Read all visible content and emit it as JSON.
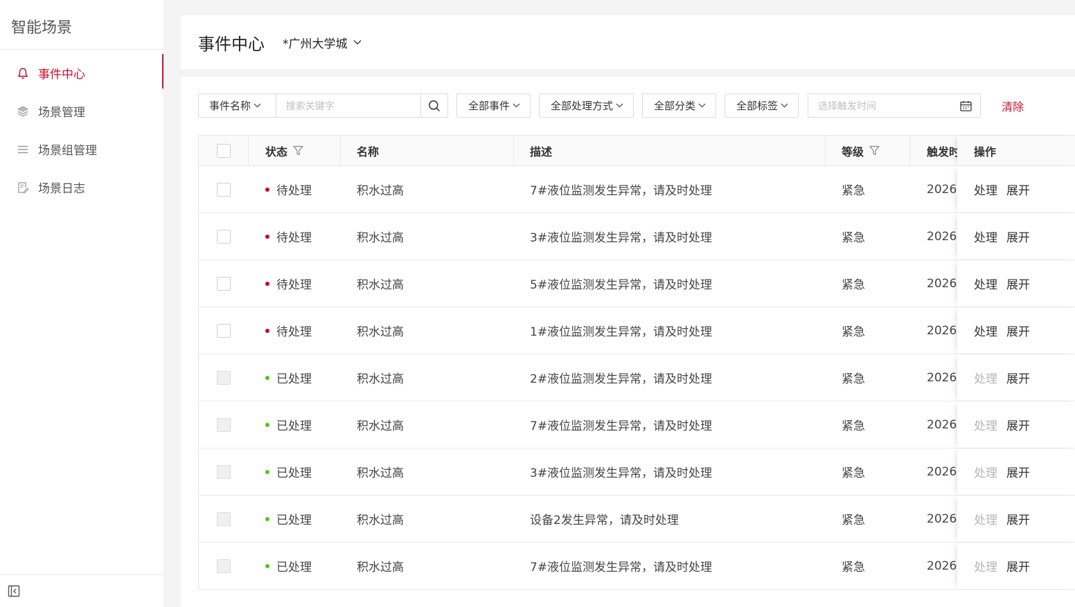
{
  "sidebar": {
    "title": "智能场景",
    "items": [
      {
        "label": "事件中心",
        "icon": "bell-icon",
        "active": true
      },
      {
        "label": "场景管理",
        "icon": "layers-icon",
        "active": false
      },
      {
        "label": "场景组管理",
        "icon": "list-icon",
        "active": false
      },
      {
        "label": "场景日志",
        "icon": "log-icon",
        "active": false
      }
    ],
    "collapse_icon": "collapse-sidebar-icon"
  },
  "header": {
    "title": "事件中心",
    "region": "*广州大学城"
  },
  "filters": {
    "search_field": "事件名称",
    "search_placeholder": "搜索关键字",
    "event_type": "全部事件",
    "handle_method": "全部处理方式",
    "category": "全部分类",
    "tag": "全部标签",
    "time_placeholder": "选择触发时间",
    "clear_label": "清除"
  },
  "table": {
    "columns": {
      "status": "状态",
      "name": "名称",
      "description": "描述",
      "level": "等级",
      "trigger_time": "触发时",
      "actions": "操作"
    },
    "rows": [
      {
        "status": "待处理",
        "status_color": "#d0021b",
        "name": "积水过高",
        "description": "7#液位监测发生异常，请及时处理",
        "level": "紧急",
        "time": "2026-",
        "handle": "处理",
        "expand": "展开",
        "handled": false
      },
      {
        "status": "待处理",
        "status_color": "#d0021b",
        "name": "积水过高",
        "description": "3#液位监测发生异常，请及时处理",
        "level": "紧急",
        "time": "2026-",
        "handle": "处理",
        "expand": "展开",
        "handled": false
      },
      {
        "status": "待处理",
        "status_color": "#d0021b",
        "name": "积水过高",
        "description": "5#液位监测发生异常，请及时处理",
        "level": "紧急",
        "time": "2026-",
        "handle": "处理",
        "expand": "展开",
        "handled": false
      },
      {
        "status": "待处理",
        "status_color": "#d0021b",
        "name": "积水过高",
        "description": "1#液位监测发生异常，请及时处理",
        "level": "紧急",
        "time": "2026-",
        "handle": "处理",
        "expand": "展开",
        "handled": false
      },
      {
        "status": "已处理",
        "status_color": "#52c41a",
        "name": "积水过高",
        "description": "2#液位监测发生异常，请及时处理",
        "level": "紧急",
        "time": "2026-",
        "handle": "处理",
        "expand": "展开",
        "handled": true
      },
      {
        "status": "已处理",
        "status_color": "#52c41a",
        "name": "积水过高",
        "description": "7#液位监测发生异常，请及时处理",
        "level": "紧急",
        "time": "2026-",
        "handle": "处理",
        "expand": "展开",
        "handled": true
      },
      {
        "status": "已处理",
        "status_color": "#52c41a",
        "name": "积水过高",
        "description": "3#液位监测发生异常，请及时处理",
        "level": "紧急",
        "time": "2026-",
        "handle": "处理",
        "expand": "展开",
        "handled": true
      },
      {
        "status": "已处理",
        "status_color": "#52c41a",
        "name": "积水过高",
        "description": "设备2发生异常，请及时处理",
        "level": "紧急",
        "time": "2026-",
        "handle": "处理",
        "expand": "展开",
        "handled": true
      },
      {
        "status": "已处理",
        "status_color": "#52c41a",
        "name": "积水过高",
        "description": "7#液位监测发生异常，请及时处理",
        "level": "紧急",
        "time": "2026-",
        "handle": "处理",
        "expand": "展开",
        "handled": true
      }
    ]
  },
  "colors": {
    "accent": "#c8102e",
    "pending": "#d0021b",
    "done": "#52c41a"
  }
}
